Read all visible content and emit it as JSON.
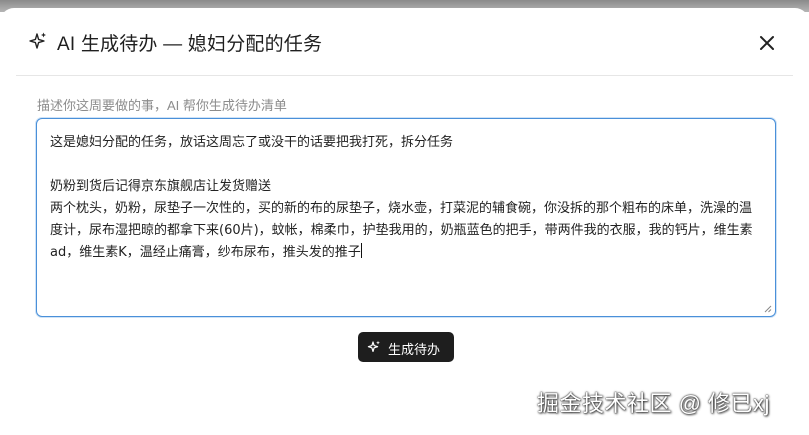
{
  "dialog": {
    "title": "AI 生成待办 — 媳妇分配的任务",
    "title_icon": "sparkle-icon",
    "close_icon": "close-icon",
    "hint": "描述你这周要做的事，AI 帮你生成待办清单"
  },
  "textarea": {
    "value": "这是媳妇分配的任务，放话这周忘了或没干的话要把我打死，拆分任务\n\n奶粉到货后记得京东旗舰店让发货赠送\n两个枕头，奶粉，尿垫子一次性的，买的新的布的尿垫子，烧水壶，打菜泥的辅食碗，你没拆的那个粗布的床单，洗澡的温度计，尿布湿把晾的都拿下来(60片)，蚊帐，棉柔巾，护垫我用的，奶瓶蓝色的把手，带两件我的衣服，我的钙片，维生素ad，维生素K，温经止痛膏，纱布尿布，推头发的推子"
  },
  "actions": {
    "generate_label": "生成待办",
    "generate_icon": "sparkle-icon"
  },
  "watermark": "掘金技术社区 @ 修已xj",
  "colors": {
    "focus_border": "#4a90d9",
    "button_bg": "#1e1e1e",
    "hint_text": "#8c8c8c"
  }
}
